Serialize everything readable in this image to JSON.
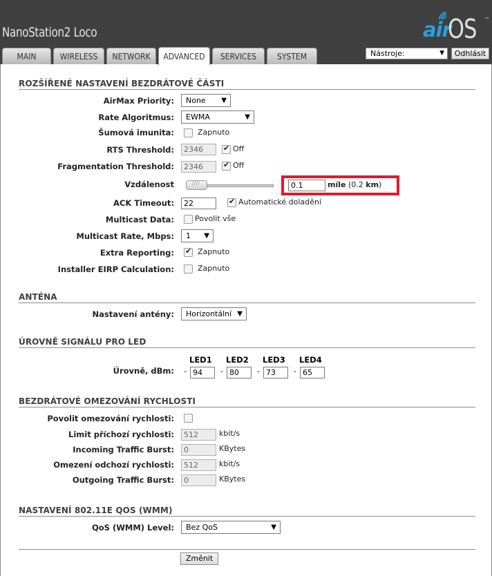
{
  "header": {
    "device_name": "NanoStation2 Loco",
    "logo": {
      "air": "air",
      "os": "OS",
      "tm": "™"
    }
  },
  "tabs": [
    {
      "label": "MAIN",
      "active": false
    },
    {
      "label": "WIRELESS",
      "active": false
    },
    {
      "label": "NETWORK",
      "active": false
    },
    {
      "label": "ADVANCED",
      "active": true
    },
    {
      "label": "SERVICES",
      "active": false
    },
    {
      "label": "SYSTEM",
      "active": false
    }
  ],
  "toolbar": {
    "tools_selected": "Nástroje:",
    "logout_label": "Odhlásit"
  },
  "wireless_advanced": {
    "title": "ROZŠÍŘENÉ NASTAVENÍ BEZDRÁTOVÉ ČÁSTI",
    "airmax_label": "AirMax Priority:",
    "airmax_value": "None",
    "rate_label": "Rate Algoritmus:",
    "rate_value": "EWMA",
    "noise_label": "Šumová imunita:",
    "noise_text": "Zapnuto",
    "rts_label": "RTS Threshold:",
    "rts_value": "2346",
    "rts_off": "Off",
    "frag_label": "Fragmentation Threshold:",
    "frag_value": "2346",
    "frag_off": "Off",
    "distance_label": "Vzdálenost",
    "distance_value": "0.1",
    "distance_unit": "míle",
    "distance_km_open": "(0.2 ",
    "distance_km": "km",
    "distance_km_close": ")",
    "ack_label": "ACK Timeout:",
    "ack_value": "22",
    "ack_auto": "Automatické doladění",
    "multicast_label": "Multicast Data:",
    "multicast_text": "Povolit vše",
    "mrate_label": "Multicast Rate, Mbps:",
    "mrate_value": "1",
    "extra_label": "Extra Reporting:",
    "extra_text": "Zapnuto",
    "eirp_label": "Installer EIRP Calculation:",
    "eirp_text": "Zapnuto"
  },
  "antenna": {
    "title": "ANTÉNA",
    "setting_label": "Nastavení antény:",
    "setting_value": "Horizontální"
  },
  "led": {
    "title": "ÚROVNĚ SIGNÁLU PRO LED",
    "label": "Úrovně, dBm:",
    "heads": [
      "LED1",
      "LED2",
      "LED3",
      "LED4"
    ],
    "values": [
      "94",
      "80",
      "73",
      "65"
    ],
    "dash": "-"
  },
  "shaping": {
    "title": "BEZDRÁTOVÉ OMEZOVÁNÍ RYCHLOSTI",
    "enable_label": "Povolit omezování rychlosti:",
    "in_limit_label": "Limit příchozí rychlosti:",
    "in_limit_value": "512",
    "in_limit_unit": "kbit/s",
    "in_burst_label": "Incoming Traffic Burst:",
    "in_burst_value": "0",
    "in_burst_unit": "KBytes",
    "out_limit_label": "Omezení odchozí rychlosti:",
    "out_limit_value": "512",
    "out_limit_unit": "kbit/s",
    "out_burst_label": "Outgoing Traffic Burst:",
    "out_burst_value": "0",
    "out_burst_unit": "KBytes"
  },
  "qos": {
    "title": "NASTAVENÍ 802.11E QOS (WMM)",
    "level_label": "QoS (WMM) Level:",
    "level_value": "Bez QoS"
  },
  "submit_label": "Změnit"
}
